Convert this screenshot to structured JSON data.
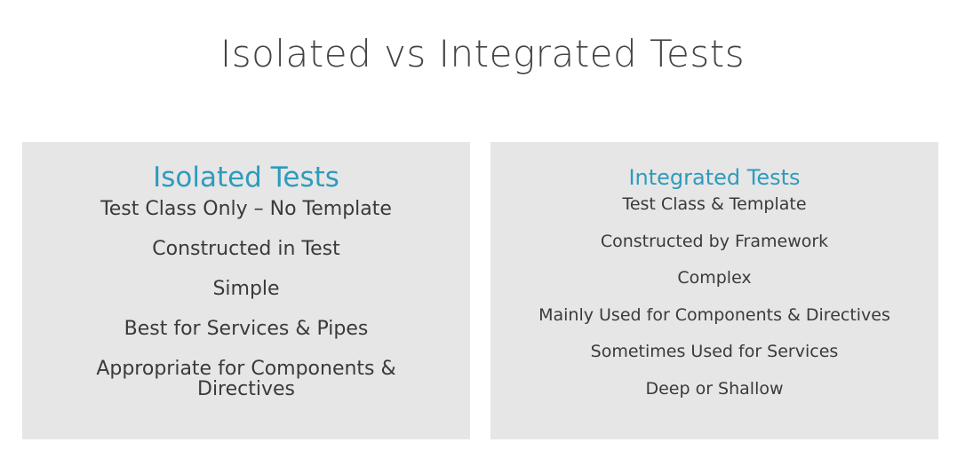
{
  "title": "Isolated vs Integrated Tests",
  "isolated": {
    "heading": "Isolated Tests",
    "items": [
      "Test Class Only – No Template",
      "Constructed in Test",
      "Simple",
      "Best for Services & Pipes",
      "Appropriate for Components & Directives"
    ]
  },
  "integrated": {
    "heading": "Integrated Tests",
    "items": [
      "Test Class & Template",
      "Constructed by Framework",
      "Complex",
      "Mainly Used for Components & Directives",
      "Sometimes Used for Services",
      "Deep or Shallow"
    ]
  },
  "colors": {
    "heading_accent": "#2e9bbd",
    "panel_background": "#e6e6e6",
    "text": "#3a3a3a"
  }
}
